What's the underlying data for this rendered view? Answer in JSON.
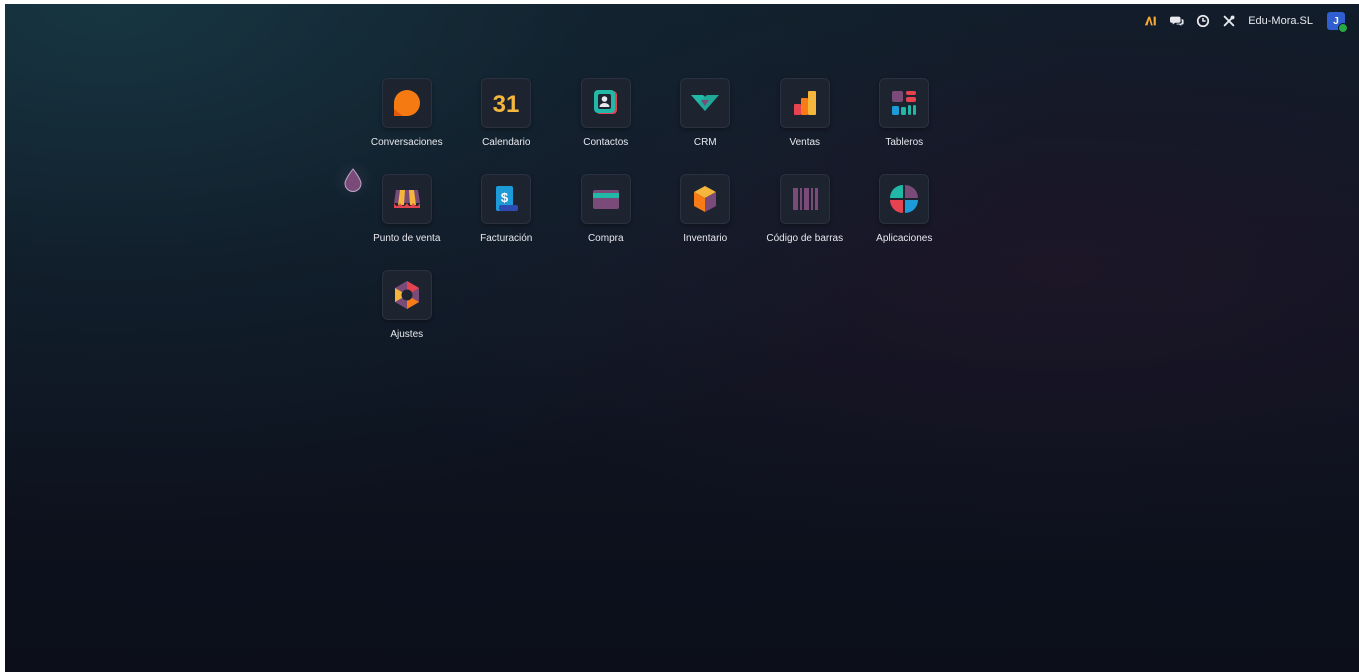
{
  "systray": {
    "ai_label": "AI",
    "icons": [
      "ai-icon",
      "chat-icon",
      "clock-icon",
      "tools-icon"
    ],
    "company": "Edu-Mora.SL",
    "avatar_initial": "J",
    "avatar_color": "#2f5fd1",
    "status_color": "#28a745"
  },
  "apps": [
    {
      "label": "Conversaciones",
      "icon": "conversaciones-icon"
    },
    {
      "label": "Calendario",
      "icon": "calendario-icon",
      "icon_text": "31"
    },
    {
      "label": "Contactos",
      "icon": "contactos-icon"
    },
    {
      "label": "CRM",
      "icon": "crm-icon"
    },
    {
      "label": "Ventas",
      "icon": "ventas-icon"
    },
    {
      "label": "Tableros",
      "icon": "tableros-icon"
    },
    {
      "label": "Punto de venta",
      "icon": "punto-de-venta-icon"
    },
    {
      "label": "Facturación",
      "icon": "facturacion-icon",
      "icon_text": "$"
    },
    {
      "label": "Compra",
      "icon": "compra-icon"
    },
    {
      "label": "Inventario",
      "icon": "inventario-icon"
    },
    {
      "label": "Código de barras",
      "icon": "codigo-de-barras-icon"
    },
    {
      "label": "Aplicaciones",
      "icon": "aplicaciones-icon"
    },
    {
      "label": "Ajustes",
      "icon": "ajustes-icon"
    }
  ],
  "colors": {
    "orange": "#f97b16",
    "teal": "#21b8a7",
    "purple": "#7a4a78",
    "red": "#e5434f",
    "blue": "#1d9bd8",
    "yellow": "#f4b63d"
  }
}
